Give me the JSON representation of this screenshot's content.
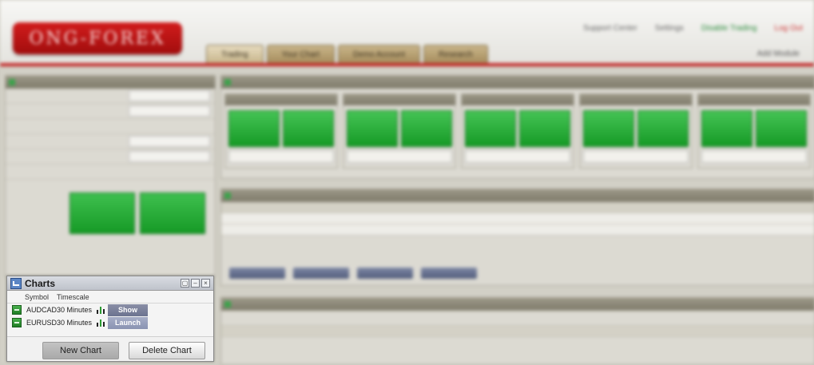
{
  "background_app": {
    "logo": "ONG-FOREX",
    "top_links": [
      "Support Center",
      "Settings",
      "Disable Trading",
      "Log Out"
    ],
    "sub_link": "Add Module",
    "tabs": [
      "Trading",
      "Your Chart",
      "Demo Account",
      "Research"
    ]
  },
  "charts_window": {
    "title": "Charts",
    "columns": {
      "symbol": "Symbol",
      "timescale": "Timescale"
    },
    "rows": [
      {
        "symbol": "AUDCAD",
        "timescale": "30 Minutes",
        "action": "Show"
      },
      {
        "symbol": "EURUSD",
        "timescale": "30 Minutes",
        "action": "Launch"
      }
    ],
    "buttons": {
      "new_chart": "New Chart",
      "delete_chart": "Delete Chart"
    },
    "controls": {
      "restore": "▢",
      "minimize": "–",
      "close": "×"
    }
  }
}
